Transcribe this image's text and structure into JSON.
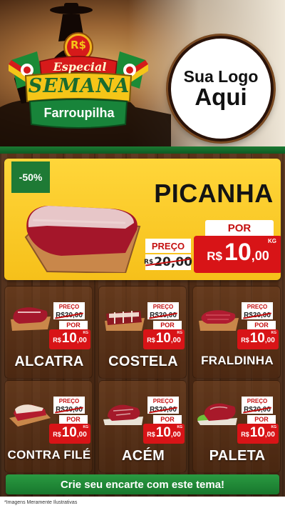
{
  "header": {
    "badge": {
      "currency": "R$",
      "line1": "Especial",
      "line2": "SEMANA",
      "line3": "Farroupilha"
    },
    "logo": {
      "line1": "Sua Logo",
      "line2": "Aqui"
    }
  },
  "hero": {
    "discount": "-50%",
    "name": "PICANHA",
    "preco_label": "PREÇO",
    "old_currency": "R$",
    "old_value": "20,00",
    "por_label": "POR",
    "currency": "R$",
    "price_int": "10",
    "price_cents": ",00",
    "unit": "KG"
  },
  "products": [
    {
      "name": "ALCATRA",
      "preco_label": "PREÇO",
      "old_value": "R$20,00",
      "por_label": "POR",
      "currency": "R$",
      "price_int": "10",
      "price_cents": ",00",
      "unit": "KG"
    },
    {
      "name": "COSTELA",
      "preco_label": "PREÇO",
      "old_value": "R$20,00",
      "por_label": "POR",
      "currency": "R$",
      "price_int": "10",
      "price_cents": ",00",
      "unit": "KG"
    },
    {
      "name": "FRALDINHA",
      "preco_label": "PREÇO",
      "old_value": "R$20,00",
      "por_label": "POR",
      "currency": "R$",
      "price_int": "10",
      "price_cents": ",00",
      "unit": "KG"
    },
    {
      "name": "CONTRA FILÉ",
      "preco_label": "PREÇO",
      "old_value": "R$20,00",
      "por_label": "POR",
      "currency": "R$",
      "price_int": "10",
      "price_cents": ",00",
      "unit": "KG"
    },
    {
      "name": "ACÉM",
      "preco_label": "PREÇO",
      "old_value": "R$20,00",
      "por_label": "POR",
      "currency": "R$",
      "price_int": "10",
      "price_cents": ",00",
      "unit": "KG"
    },
    {
      "name": "PALETA",
      "preco_label": "PREÇO",
      "old_value": "R$20,00",
      "por_label": "POR",
      "currency": "R$",
      "price_int": "10",
      "price_cents": ",00",
      "unit": "KG"
    }
  ],
  "cta": {
    "label": "Crie seu encarte com este tema!"
  },
  "footer": {
    "disclaimer": "*Imagens Meramente Ilustrativas"
  },
  "colors": {
    "accent_red": "#d81417",
    "accent_green": "#1e7a35",
    "hero_yellow": "#f6c01a",
    "wood": "#4a2914"
  }
}
